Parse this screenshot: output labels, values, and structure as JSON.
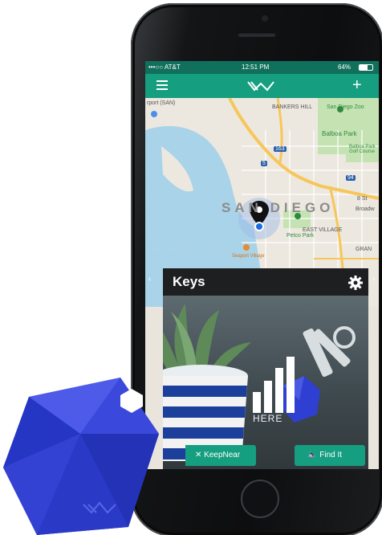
{
  "status_bar": {
    "carrier": "•••○○ AT&T",
    "time": "12:51 PM",
    "battery": "64%"
  },
  "nav_bar": {
    "menu_icon": "hamburger-menu-icon",
    "logo_icon": "xy-logo-icon",
    "add_label": "+"
  },
  "map": {
    "city_label": "SAN DIEGO",
    "labels": {
      "bankers_hill": "BANKERS HILL",
      "san_diego_zoo": "San Diego Zoo",
      "balboa_park": "Balboa Park",
      "balboa_golf": "Balboa Park Golf Course",
      "east_village": "EAST VILLAGE",
      "petco_park": "Petco Park",
      "seaport_village": "Seaport Village",
      "gran": "GRAN",
      "broadway": "Broadw",
      "airport_code": "rport (SAN)",
      "st_8": "8 St",
      "highway_5": "5",
      "highway_163": "163",
      "highway_94": "94"
    },
    "colors": {
      "water": "#a9d3e8",
      "land": "#ece8df",
      "park": "#c5e3b2",
      "highway": "#f7c65a"
    }
  },
  "card": {
    "title": "Keys",
    "status_text": "HERE",
    "keepnear_label": "KeepNear",
    "findit_label": "Find It"
  },
  "colors": {
    "accent": "#169e80",
    "accent_dark": "#11705c",
    "tracker": "#2f3fd1"
  }
}
